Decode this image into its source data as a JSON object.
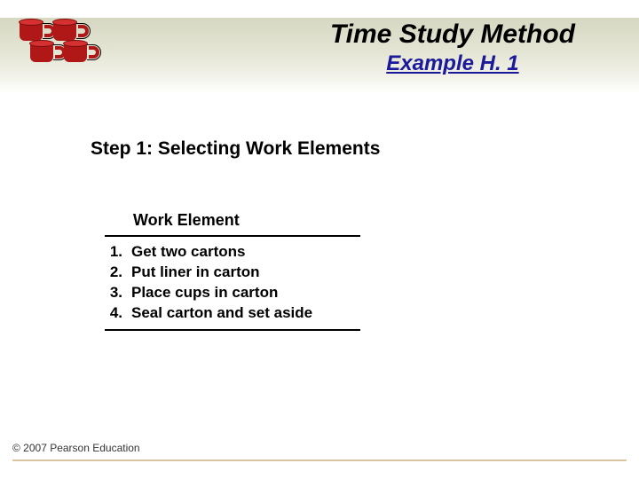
{
  "header": {
    "title": "Time Study Method",
    "subtitle": "Example H. 1"
  },
  "step_heading": "Step 1: Selecting Work Elements",
  "table": {
    "header": "Work Element",
    "rows": [
      {
        "num": "1.",
        "text": "Get two cartons"
      },
      {
        "num": "2.",
        "text": "Put liner in carton"
      },
      {
        "num": "3.",
        "text": "Place cups in carton"
      },
      {
        "num": "4.",
        "text": "Seal carton and set aside"
      }
    ]
  },
  "footer": "© 2007 Pearson Education"
}
